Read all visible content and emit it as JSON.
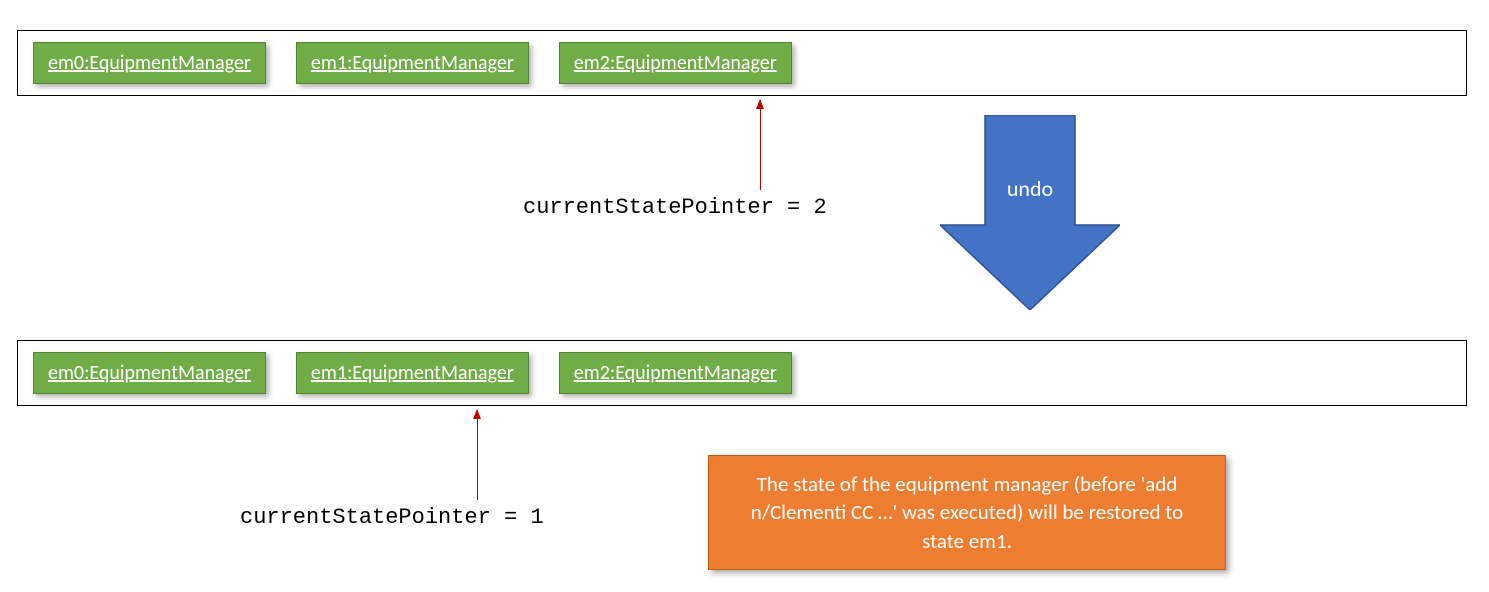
{
  "topContainer": {
    "states": [
      {
        "label": "em0:EquipmentManager"
      },
      {
        "label": "em1:EquipmentManager"
      },
      {
        "label": "em2:EquipmentManager"
      }
    ]
  },
  "bottomContainer": {
    "states": [
      {
        "label": "em0:EquipmentManager"
      },
      {
        "label": "em1:EquipmentManager"
      },
      {
        "label": "em2:EquipmentManager"
      }
    ]
  },
  "pointer1": {
    "label": "currentStatePointer = 2"
  },
  "pointer2": {
    "label": "currentStatePointer = 1"
  },
  "undoArrow": {
    "label": "undo"
  },
  "callout": {
    "text": "The state of the equipment manager (before 'add n/Clementi CC …' was executed) will be restored to state em1."
  }
}
